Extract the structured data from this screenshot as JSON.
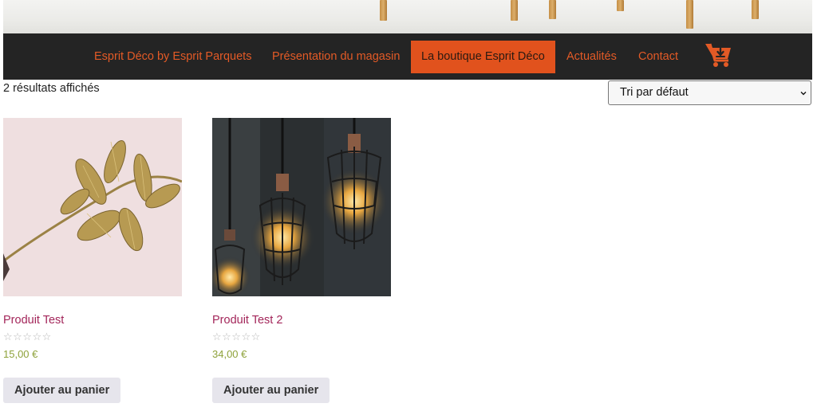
{
  "nav": {
    "items": [
      {
        "label": "Esprit Déco by Esprit Parquets",
        "active": false
      },
      {
        "label": "Présentation du magasin",
        "active": false
      },
      {
        "label": "La boutique Esprit Déco",
        "active": true
      },
      {
        "label": "Actualités",
        "active": false
      },
      {
        "label": "Contact",
        "active": false
      }
    ],
    "cart_icon": "shopping-cart-download-icon",
    "text_color": "#e35a26",
    "active_bg": "#e1521d",
    "bar_bg": "#242424"
  },
  "shop": {
    "result_count": "2 résultats affichés",
    "sort_selected": "Tri par défaut"
  },
  "products": [
    {
      "title": "Produit Test",
      "price": "15,00 €",
      "rating": "☆☆☆☆☆",
      "button": "Ajouter au panier",
      "image": "golden-leaf-branch-image"
    },
    {
      "title": "Produit Test 2",
      "price": "34,00 €",
      "rating": "☆☆☆☆☆",
      "button": "Ajouter au panier",
      "image": "hanging-edison-bulbs-image"
    }
  ],
  "colors": {
    "product_title": "#a3265a",
    "price": "#8ea23a",
    "button_bg": "#e6e5ec"
  }
}
